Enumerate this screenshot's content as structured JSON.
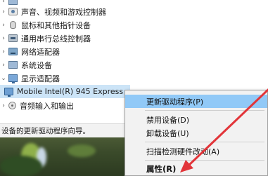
{
  "device_tree": {
    "categories": [
      {
        "label": "声音、视频和游戏控制器",
        "icon": "sound-device-icon"
      },
      {
        "label": "鼠标和其他指针设备",
        "icon": "mouse-icon"
      },
      {
        "label": "通用串行总线控制器",
        "icon": "usb-controller-icon"
      },
      {
        "label": "网络适配器",
        "icon": "network-adapter-icon"
      },
      {
        "label": "系统设备",
        "icon": "system-device-icon"
      },
      {
        "label": "显示适配器",
        "icon": "display-adapter-icon"
      }
    ],
    "selected_device": {
      "label": "Mobile Intel(R) 945 Express",
      "icon": "monitor-icon"
    },
    "after_selected": {
      "label": "音频输入和输出",
      "icon": "audio-device-icon"
    }
  },
  "context_menu": {
    "items": [
      {
        "label": "更新驱动程序(P)",
        "hovered": true
      },
      {
        "label": "禁用设备(D)"
      },
      {
        "label": "卸载设备(U)"
      },
      {
        "label": "扫描检测硬件改动(A)"
      },
      {
        "label": "属性(R)",
        "bold": true
      }
    ]
  },
  "status_bar": {
    "text": "设备的更新驱动程序向导。"
  },
  "colors": {
    "selection": "#cce4f7",
    "menu_hover": "#91c9f7",
    "annotation_arrow": "#e2353a"
  }
}
